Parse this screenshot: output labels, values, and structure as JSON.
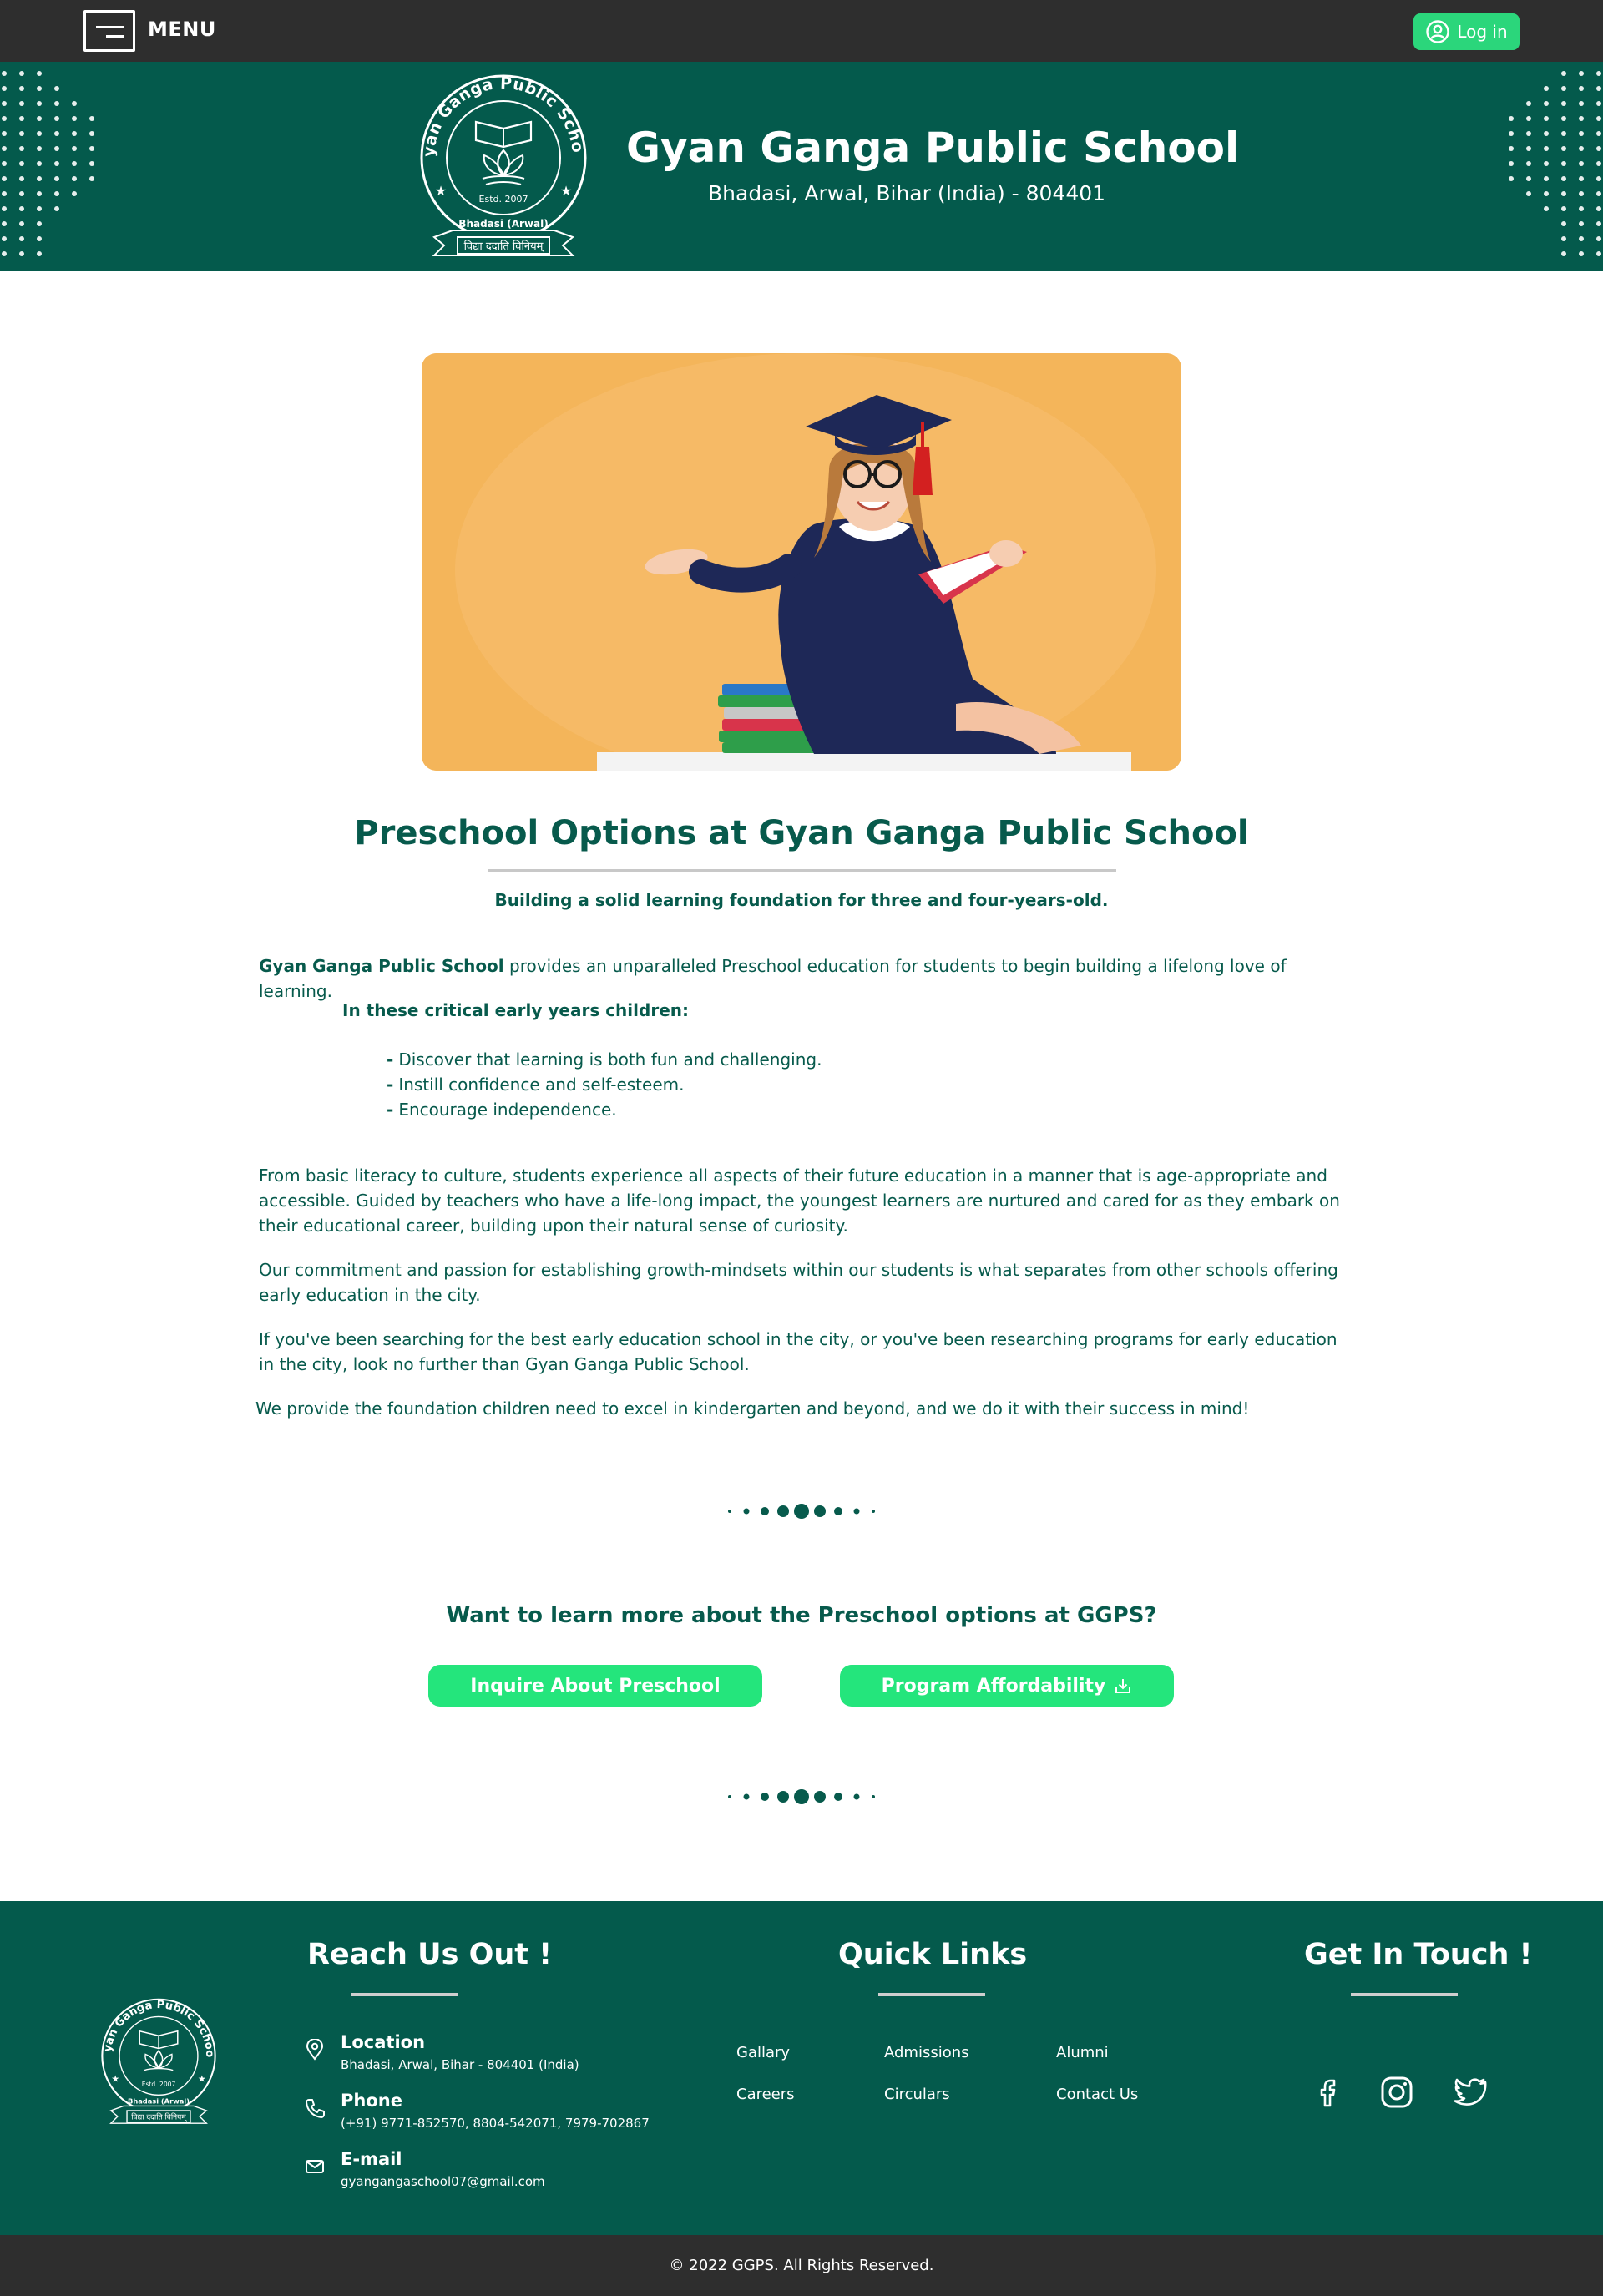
{
  "topbar": {
    "menu_label": "MENU",
    "login_label": "Log in"
  },
  "header": {
    "school_name": "Gyan Ganga Public School",
    "address": "Bhadasi, Arwal, Bihar (India) - 804401",
    "logo": {
      "ring_text": "Gyan Ganga Public School",
      "estd": "Estd. 2007",
      "place": "Bhadasi (Arwal)",
      "motto": "विद्या ददाति विनियम्"
    }
  },
  "content": {
    "title": "Preschool Options at Gyan Ganga Public School",
    "subtitle": "Building a solid learning foundation for three and four-years-old.",
    "intro_bold": "Gyan Ganga Public School",
    "intro_rest": " provides an unparalleled Preschool education for students to begin building a lifelong love of learning.",
    "children_heading": "In these critical early years children:",
    "bullets": [
      "Discover that learning is both fun and challenging.",
      "Instill confidence and self-esteem.",
      "Encourage independence."
    ],
    "paragraphs": [
      "From basic literacy to culture, students experience all aspects of their future education in a manner that is age-appropriate and accessible. Guided by teachers who have a life-long impact, the youngest learners are nurtured and cared for as they embark on their educational career, building upon their natural sense of curiosity.",
      "Our commitment and passion for establishing growth-mindsets within our students is what separates from other schools offering early education in the city.",
      "If you've been searching for the best early education school in the city, or you've been researching programs for early education in the city, look no further than Gyan Ganga Public School.",
      "We provide the foundation children need to excel in kindergarten and beyond, and we do it with their success in mind!"
    ]
  },
  "cta": {
    "question": "Want to learn more about the Preschool options at GGPS?",
    "inquire_label": "Inquire About Preschool",
    "affordability_label": "Program Affordability"
  },
  "footer": {
    "reach_heading": "Reach Us Out !",
    "links_heading": "Quick Links",
    "touch_heading": "Get In Touch !",
    "contacts": [
      {
        "title": "Location",
        "value": "Bhadasi, Arwal, Bihar - 804401 (India)",
        "icon": "location-pin-icon"
      },
      {
        "title": "Phone",
        "value": "(+91) 9771-852570, 8804-542071, 7979-702867",
        "icon": "phone-icon"
      },
      {
        "title": "E-mail",
        "value": "gyangangaschool07@gmail.com",
        "icon": "mail-icon"
      }
    ],
    "links": [
      "Gallary",
      "Admissions",
      "Alumni",
      "Careers",
      "Circulars",
      "Contact Us"
    ],
    "social": [
      "facebook-icon",
      "instagram-icon",
      "twitter-icon"
    ]
  },
  "copyright": "© 2022 GGPS. All Rights Reserved.",
  "colors": {
    "brand_green": "#045a4c",
    "accent_green": "#24e57c",
    "bar_dark": "#2e2e2e"
  }
}
